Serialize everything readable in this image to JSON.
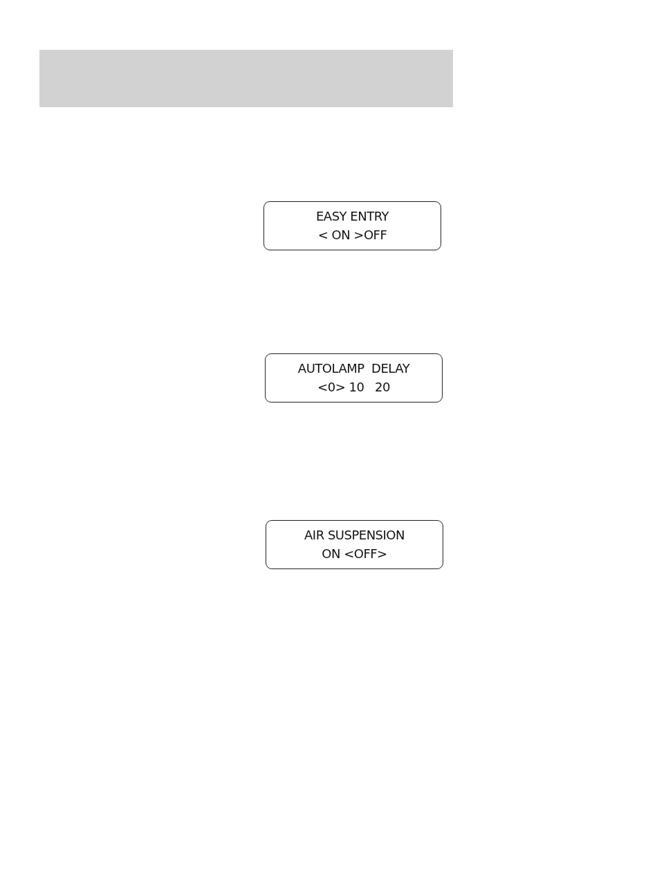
{
  "displays": [
    {
      "title": "EASY ENTRY",
      "options": "< ON >OFF"
    },
    {
      "title": "AUTOLAMP  DELAY",
      "options": "<0> 10   20"
    },
    {
      "title": "AIR SUSPENSION",
      "options": "ON <OFF>"
    }
  ]
}
